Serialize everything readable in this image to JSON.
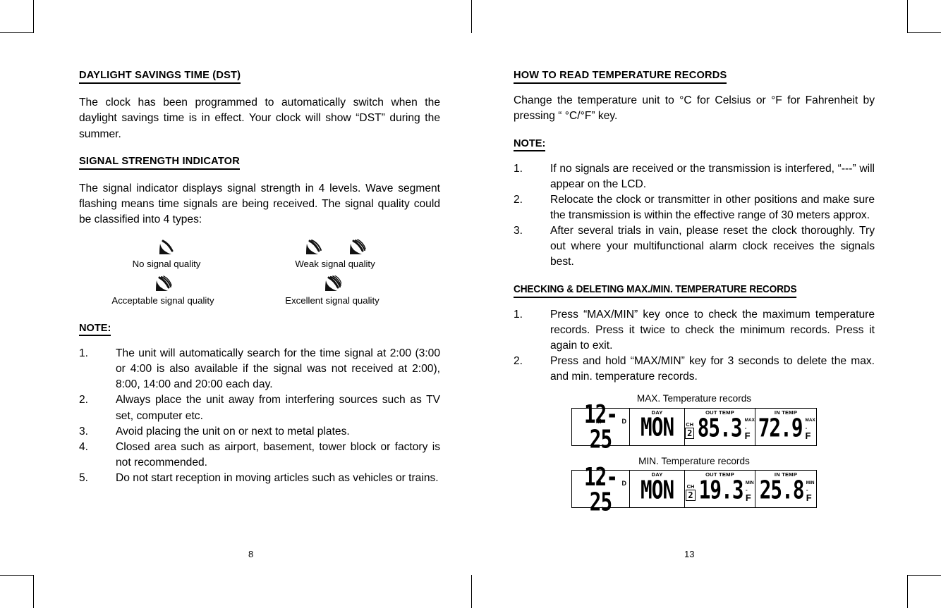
{
  "document": {
    "type": "instruction-manual-spread",
    "left_page_number": "8",
    "right_page_number": "13"
  },
  "left_page": {
    "section1": {
      "heading": "DAYLIGHT SAVINGS TIME (DST)",
      "paragraph": "The clock has been programmed to automatically switch when the daylight savings time is in effect. Your clock will show “DST” during the summer."
    },
    "section2": {
      "heading": "SIGNAL STRENGTH INDICATOR",
      "paragraph": "The signal indicator displays signal strength in 4 levels. Wave segment flashing means time signals are being received. The signal quality could be classified into 4 types:",
      "signal_levels": [
        {
          "label": "No signal quality",
          "icon": "signal-wave-icon",
          "arcs": 1
        },
        {
          "label": "Weak signal quality",
          "icon": "signal-wave-icon",
          "arcs": 2
        },
        {
          "label": "Acceptable signal quality",
          "icon": "signal-wave-icon",
          "arcs": 3
        },
        {
          "label": "Excellent signal quality",
          "icon": "signal-wave-icon",
          "arcs": 4
        }
      ]
    },
    "note": {
      "title": "NOTE:",
      "items": [
        {
          "num": "1.",
          "text": "The unit will automatically search for the time signal at 2:00 (3:00 or 4:00 is also available if the signal was not received at 2:00), 8:00, 14:00 and 20:00 each day."
        },
        {
          "num": "2.",
          "text": "Always place the unit away from interfering sources such as TV set, computer etc."
        },
        {
          "num": "3.",
          "text": "Avoid placing the unit on or next to metal plates."
        },
        {
          "num": "4.",
          "text": "Closed area such as airport, basement, tower block or factory is not recommended."
        },
        {
          "num": "5.",
          "text": "Do not start reception in moving articles such as vehicles or trains."
        }
      ]
    }
  },
  "right_page": {
    "section1": {
      "heading": "HOW TO READ TEMPERATURE RECORDS",
      "paragraph": "Change the temperature unit to °C for Celsius or °F for Fahrenheit by pressing “ °C/°F” key."
    },
    "note": {
      "title": "NOTE:",
      "items": [
        {
          "num": "1.",
          "text": "If no signals are received or the transmission is interfered, “---” will appear on the LCD."
        },
        {
          "num": "2.",
          "text": "Relocate the clock or transmitter in other positions and make sure the transmission is within the effective range of 30 meters approx."
        },
        {
          "num": "3.",
          "text": "After several trials in vain, please reset the clock thoroughly. Try out where your multifunctional alarm clock receives the signals best."
        }
      ]
    },
    "section2": {
      "heading": "CHECKING & DELETING MAX./MIN. TEMPERATURE RECORDS",
      "items": [
        {
          "num": "1.",
          "text": "Press “MAX/MIN” key once to check the maximum temperature records. Press it twice to check the minimum records. Press it again to exit."
        },
        {
          "num": "2.",
          "text": "Press and hold “MAX/MIN” key for 3 seconds to delete the max. and min. temperature records."
        }
      ]
    },
    "lcd_max": {
      "caption": "MAX. Temperature records",
      "date": "12-25",
      "month_sup": "M",
      "day_sup": "D",
      "day_title": "DAY",
      "day_value": "MON",
      "out_title": "OUT TEMP",
      "out_ch_label": "CH",
      "out_ch_value": "2",
      "out_value": "85.3",
      "out_minmax": "MAX",
      "out_deg": "°",
      "out_unit": "F",
      "in_title": "IN TEMP",
      "in_value": "72.9",
      "in_minmax": "MAX",
      "in_deg": "°",
      "in_unit": "F"
    },
    "lcd_min": {
      "caption": "MIN. Temperature records",
      "date": "12-25",
      "month_sup": "M",
      "day_sup": "D",
      "day_title": "DAY",
      "day_value": "MON",
      "out_title": "OUT TEMP",
      "out_ch_label": "CH",
      "out_ch_value": "2",
      "out_value": "19.3",
      "out_minmax": "MIN",
      "out_deg": "°",
      "out_unit": "F",
      "in_title": "IN TEMP",
      "in_value": "25.8",
      "in_minmax": "MIN",
      "in_deg": "°",
      "in_unit": "F"
    }
  }
}
